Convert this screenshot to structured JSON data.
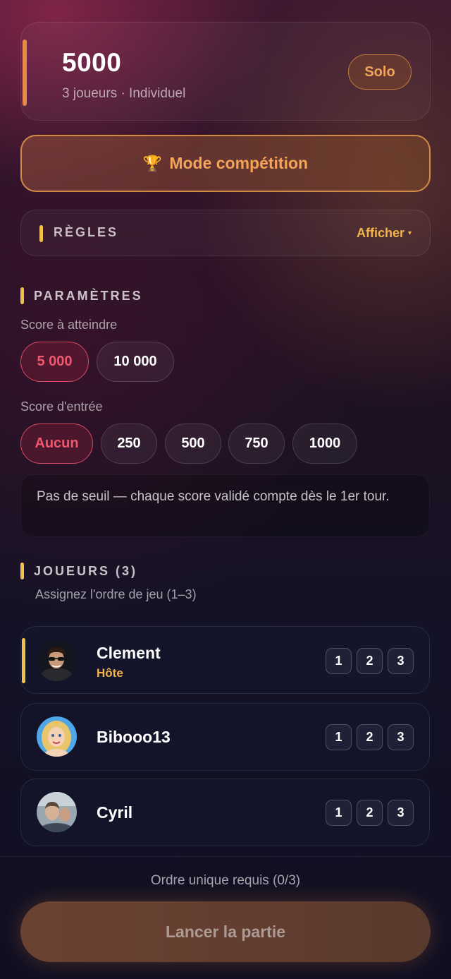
{
  "header": {
    "title": "5000",
    "subtitle": "3 joueurs · Individuel",
    "badge": "Solo"
  },
  "competition": {
    "icon": "🏆",
    "label": "Mode compétition"
  },
  "rules": {
    "title": "RÈGLES",
    "toggle_label": "Afficher",
    "toggle_icon": "▾"
  },
  "settings": {
    "title": "PARAMÈTRES",
    "target_score_label": "Score à atteindre",
    "target_options": [
      "5 000",
      "10 000"
    ],
    "target_selected": "5 000",
    "entry_score_label": "Score d'entrée",
    "entry_options": [
      "Aucun",
      "250",
      "500",
      "750",
      "1000"
    ],
    "entry_selected": "Aucun",
    "threshold_info": "Pas de seuil — chaque score validé compte dès le 1er tour."
  },
  "players": {
    "title": "JOUEURS (3)",
    "subtitle": "Assignez l'ordre de jeu (1–3)",
    "order_options": [
      "1",
      "2",
      "3"
    ],
    "list": [
      {
        "name": "Clement",
        "role": "Hôte"
      },
      {
        "name": "Bibooo13"
      },
      {
        "name": "Cyril"
      }
    ]
  },
  "footer": {
    "status": "Ordre unique requis (0/3)",
    "launch_label": "Lancer la partie"
  },
  "colors": {
    "accent_orange": "#f4a357",
    "accent_yellow": "#f2c14b",
    "active_red": "#f0566e"
  }
}
